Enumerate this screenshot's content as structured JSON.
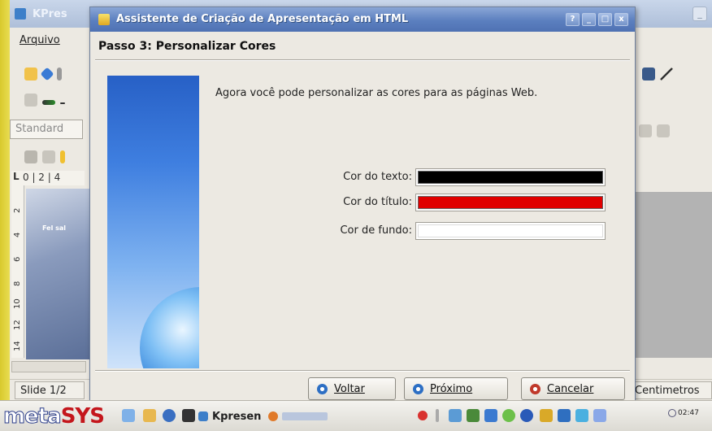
{
  "background_app": {
    "title": "KPres",
    "menu_file": "Arquivo",
    "style_combo": "Standard",
    "ruler_h": "0 | 2 | 4",
    "ruler_v_marks": [
      "2",
      "4",
      "6",
      "8",
      "10",
      "12",
      "14"
    ],
    "canvas_text": "Fel sal",
    "status_slide": "Slide 1/2",
    "status_unit": "Centimetros"
  },
  "dialog": {
    "title": "Assistente de Criação de Apresentação em HTML",
    "title_buttons": [
      "?",
      "_",
      "□",
      "x"
    ],
    "step_title": "Passo 3: Personalizar Cores",
    "intro": "Agora você pode personalizar as cores para as páginas Web.",
    "colors": [
      {
        "label": "Cor do texto:",
        "color": "#000000"
      },
      {
        "label": "Cor do título:",
        "color": "#e00000"
      },
      {
        "label": "Cor de fundo:",
        "color": "#ffffff"
      }
    ],
    "buttons": {
      "back": "Voltar",
      "next": "Próximo",
      "cancel": "Cancelar"
    }
  },
  "taskbar": {
    "brand_meta": "meta",
    "brand_sys": "SYS",
    "task_kpresenter": "Kpresen",
    "clock": "02:47"
  }
}
